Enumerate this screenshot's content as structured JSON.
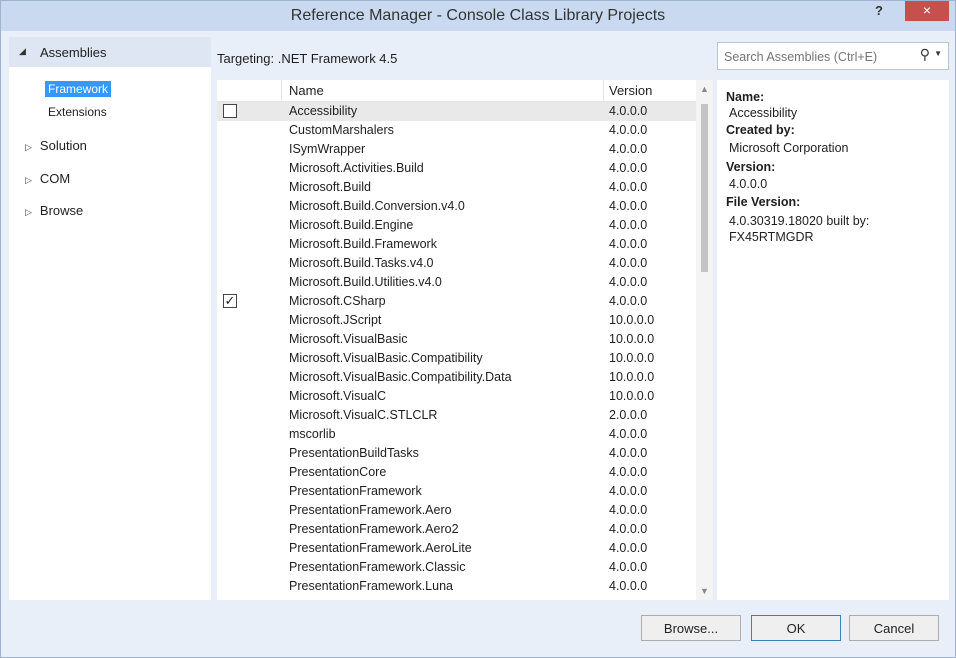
{
  "window": {
    "title": "Reference Manager - Console Class Library Projects",
    "help": "?",
    "close": "×"
  },
  "nav": {
    "header": "Assemblies",
    "subitems": [
      "Framework",
      "Extensions"
    ],
    "groups": [
      "Solution",
      "COM",
      "Browse"
    ]
  },
  "targeting": "Targeting: .NET Framework 4.5",
  "search": {
    "placeholder": "Search Assemblies (Ctrl+E)"
  },
  "list": {
    "columns": {
      "name": "Name",
      "version": "Version"
    },
    "rows": [
      {
        "name": "Accessibility",
        "version": "4.0.0.0",
        "checked": false,
        "selected": true
      },
      {
        "name": "CustomMarshalers",
        "version": "4.0.0.0",
        "checked": false
      },
      {
        "name": "ISymWrapper",
        "version": "4.0.0.0",
        "checked": false
      },
      {
        "name": "Microsoft.Activities.Build",
        "version": "4.0.0.0",
        "checked": false
      },
      {
        "name": "Microsoft.Build",
        "version": "4.0.0.0",
        "checked": false
      },
      {
        "name": "Microsoft.Build.Conversion.v4.0",
        "version": "4.0.0.0",
        "checked": false
      },
      {
        "name": "Microsoft.Build.Engine",
        "version": "4.0.0.0",
        "checked": false
      },
      {
        "name": "Microsoft.Build.Framework",
        "version": "4.0.0.0",
        "checked": false
      },
      {
        "name": "Microsoft.Build.Tasks.v4.0",
        "version": "4.0.0.0",
        "checked": false
      },
      {
        "name": "Microsoft.Build.Utilities.v4.0",
        "version": "4.0.0.0",
        "checked": false
      },
      {
        "name": "Microsoft.CSharp",
        "version": "4.0.0.0",
        "checked": true
      },
      {
        "name": "Microsoft.JScript",
        "version": "10.0.0.0",
        "checked": false
      },
      {
        "name": "Microsoft.VisualBasic",
        "version": "10.0.0.0",
        "checked": false
      },
      {
        "name": "Microsoft.VisualBasic.Compatibility",
        "version": "10.0.0.0",
        "checked": false
      },
      {
        "name": "Microsoft.VisualBasic.Compatibility.Data",
        "version": "10.0.0.0",
        "checked": false
      },
      {
        "name": "Microsoft.VisualC",
        "version": "10.0.0.0",
        "checked": false
      },
      {
        "name": "Microsoft.VisualC.STLCLR",
        "version": "2.0.0.0",
        "checked": false
      },
      {
        "name": "mscorlib",
        "version": "4.0.0.0",
        "checked": false
      },
      {
        "name": "PresentationBuildTasks",
        "version": "4.0.0.0",
        "checked": false
      },
      {
        "name": "PresentationCore",
        "version": "4.0.0.0",
        "checked": false
      },
      {
        "name": "PresentationFramework",
        "version": "4.0.0.0",
        "checked": false
      },
      {
        "name": "PresentationFramework.Aero",
        "version": "4.0.0.0",
        "checked": false
      },
      {
        "name": "PresentationFramework.Aero2",
        "version": "4.0.0.0",
        "checked": false
      },
      {
        "name": "PresentationFramework.AeroLite",
        "version": "4.0.0.0",
        "checked": false
      },
      {
        "name": "PresentationFramework.Classic",
        "version": "4.0.0.0",
        "checked": false
      },
      {
        "name": "PresentationFramework.Luna",
        "version": "4.0.0.0",
        "checked": false
      }
    ]
  },
  "details": [
    {
      "label": "Name:",
      "value": "Accessibility"
    },
    {
      "label": "Created by:",
      "value": "Microsoft Corporation"
    },
    {
      "label": "Version:",
      "value": "4.0.0.0"
    },
    {
      "label": "File Version:",
      "value": "4.0.30319.18020 built by:",
      "value2": "FX45RTMGDR"
    }
  ],
  "buttons": {
    "browse": "Browse...",
    "ok": "OK",
    "cancel": "Cancel"
  },
  "icons": {
    "search": "search-icon",
    "close": "close-icon",
    "checkmark": "✓"
  },
  "colors": {
    "selection": "#3399ff",
    "close": "#c7504f",
    "chrome": "#e8eff8"
  }
}
